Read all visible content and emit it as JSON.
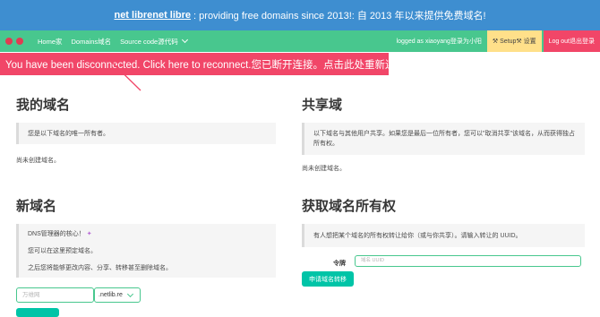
{
  "banner": {
    "link": "net librenet libre",
    "text": ": providing free domains since 2013!: 自 2013 年以来提供免费域名!"
  },
  "nav": {
    "home": "Home家",
    "domains": "Domains域名",
    "source": "Source code源代码",
    "logged": "logged as xiaoyang登录为小阳",
    "setup": "⚒ Setup⚒ 设置",
    "logout": "Log out退出登录"
  },
  "alert": {
    "text": "You have been disconnected. Click here to reconnect.您已断开连接。点击此处重新连接。"
  },
  "my_domains": {
    "title": "我的域名",
    "note": "您是以下域名的唯一所有者。",
    "empty": "尚未创建域名。"
  },
  "shared": {
    "title": "共享域",
    "note": "以下域名与其他用户共享。如果您是最后一位所有者，您可以\"取消共享\"该域名，从而获得独占所有权。",
    "empty": "尚未创建域名。"
  },
  "new_domain": {
    "title": "新域名",
    "line1": "DNS管理器的核心！",
    "line2": "您可以在这里预定域名。",
    "line3": "之后您将能够更改内容、分享、转移甚至删除域名。",
    "input_placeholder": "万维网",
    "suffix": ".netlib.re"
  },
  "claim": {
    "title": "获取域名所有权",
    "note": "有人想把某个域名的所有权转让给你（或与你共享）。请输入转让的 UUID。",
    "token_label": "令牌",
    "token_placeholder": "域名 UUID",
    "button": "申请域名转移"
  },
  "colors": {
    "banner": "#3e8ed0",
    "navbar": "#48c78e",
    "alert": "#f14668",
    "setup": "#ffe08a",
    "button": "#00c4a7"
  }
}
